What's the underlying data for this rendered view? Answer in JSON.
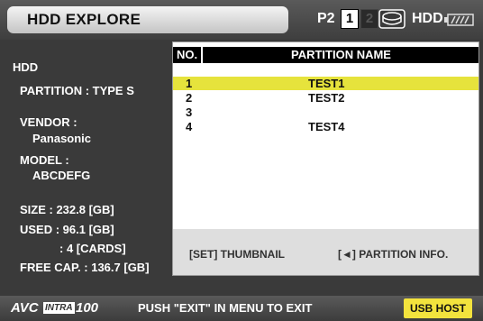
{
  "header": {
    "title": "HDD EXPLORE",
    "slot_label": "P2",
    "slot1": "1",
    "slot2": "2",
    "hdd_label": "HDD",
    "disk_icon": "disk-icon",
    "battery_icon": "battery-icon"
  },
  "info": {
    "device": "HDD",
    "partition": "PARTITION : TYPE S",
    "vendor_label": "VENDOR :",
    "vendor_value": "Panasonic",
    "model_label": "MODEL :",
    "model_value": "ABCDEFG",
    "size": "SIZE : 232.8 [GB]",
    "used": "USED :  96.1 [GB]",
    "used_cards": ": 4 [CARDS]",
    "free_cap": "FREE CAP. : 136.7 [GB]"
  },
  "list": {
    "col_no": "NO.",
    "col_name": "PARTITION NAME",
    "rows": [
      {
        "no": "1",
        "name": "TEST1",
        "selected": true
      },
      {
        "no": "2",
        "name": "TEST2",
        "selected": false
      },
      {
        "no": "3",
        "name": "",
        "selected": false
      },
      {
        "no": "4",
        "name": "TEST4",
        "selected": false
      }
    ]
  },
  "footer": {
    "thumbnail": "[SET] THUMBNAIL",
    "partition_info": "[◄] PARTITION INFO."
  },
  "status": {
    "brand_avc": "AVC",
    "brand_intra": "INTRA",
    "brand_num": "100",
    "message": "PUSH \"EXIT\" IN MENU TO EXIT",
    "usb_host": "USB HOST"
  },
  "colors": {
    "highlight": "#e6e33c",
    "usb_host_bg": "#f3e33d",
    "background": "#3a3a3a"
  }
}
